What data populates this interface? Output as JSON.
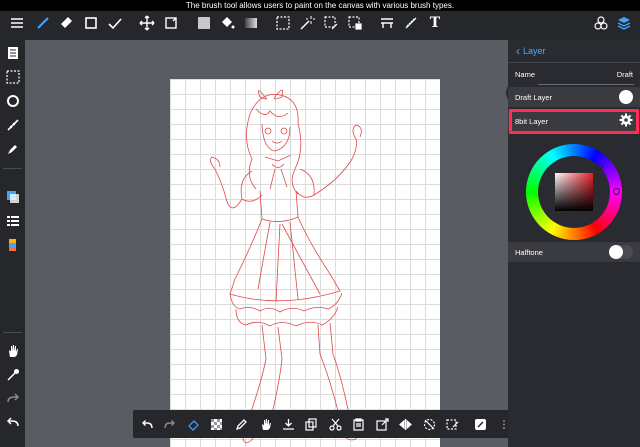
{
  "tooltip": "The brush tool allows users to paint on the canvas with various brush types.",
  "toolbar": {
    "text_tool_label": "T"
  },
  "layer_panel": {
    "back_label": "Layer",
    "name_label": "Name",
    "name_value": "Draft",
    "draft_layer_label": "Draft Layer",
    "draft_layer_on": true,
    "bit_layer_label": "8bit Layer",
    "halftone_label": "Halftone",
    "halftone_on": false,
    "selected_color": "#e8202a"
  },
  "colors": {
    "accent": "#3fa5ff",
    "highlight": "#ff2d55",
    "sketch": "#e04848"
  }
}
